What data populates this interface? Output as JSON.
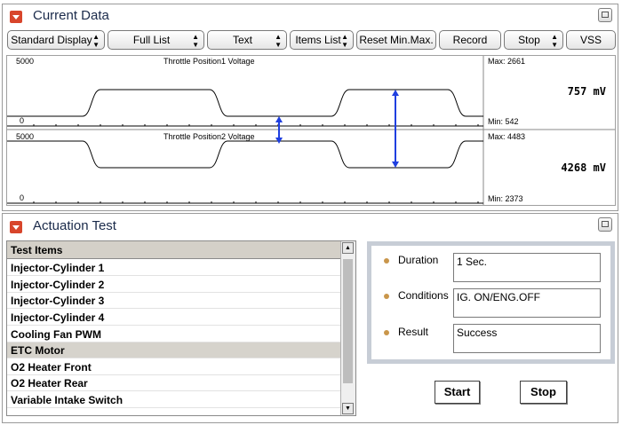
{
  "current_data": {
    "title": "Current Data",
    "toolbar": [
      {
        "label": "Standard Display",
        "spinner": true
      },
      {
        "label": "Full List",
        "spinner": true
      },
      {
        "label": "Text",
        "spinner": true
      },
      {
        "label": "Items List",
        "spinner": true
      },
      {
        "label": "Reset Min.Max.",
        "spinner": false
      },
      {
        "label": "Record",
        "spinner": false
      },
      {
        "label": "Stop",
        "spinner": true
      },
      {
        "label": "VSS",
        "spinner": false
      }
    ],
    "graphs": [
      {
        "title": "Throttle Position1 Voltage",
        "y_max_label": "5000",
        "y_min_label": "0",
        "max": "Max: 2661",
        "min": "Min: 542",
        "value": "757 mV"
      },
      {
        "title": "Throttle Position2 Voltage",
        "y_max_label": "5000",
        "y_min_label": "0",
        "max": "Max: 4483",
        "min": "Min: 2373",
        "value": "4268 mV"
      }
    ],
    "trace_color": "#000000",
    "marker_color": "#1f3fe0"
  },
  "actuation_test": {
    "title": "Actuation Test",
    "list_header": "Test Items",
    "items": [
      "Injector-Cylinder 1",
      "Injector-Cylinder 2",
      "Injector-Cylinder 3",
      "Injector-Cylinder 4",
      "Cooling Fan PWM",
      "ETC Motor",
      "O2 Heater Front",
      "O2 Heater Rear",
      "Variable Intake Switch"
    ],
    "selected_item": "ETC Motor",
    "conditions": [
      {
        "label": "Duration",
        "value": "1 Sec."
      },
      {
        "label": "Conditions",
        "value": "IG. ON/ENG.OFF"
      },
      {
        "label": "Result",
        "value": "Success"
      }
    ],
    "start_label": "Start",
    "stop_label": "Stop"
  }
}
